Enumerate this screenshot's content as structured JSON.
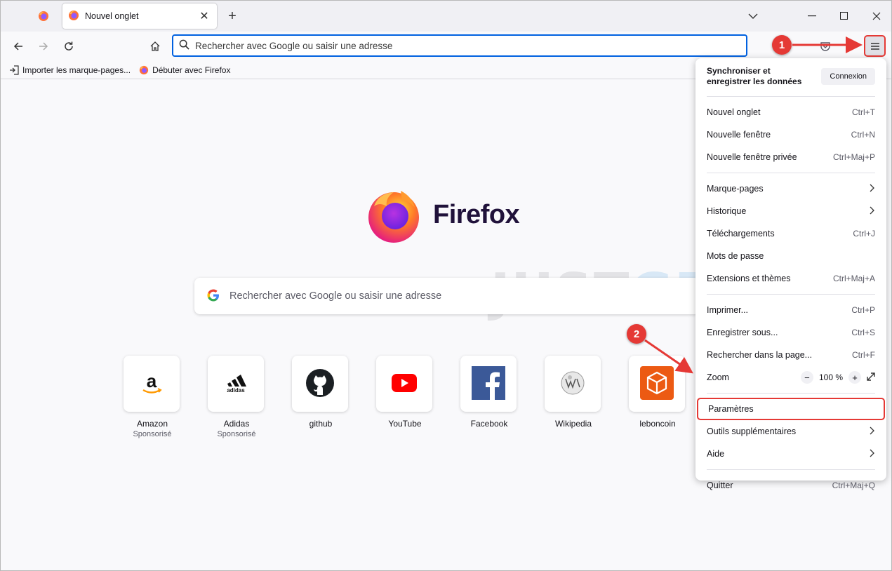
{
  "tab": {
    "title": "Nouvel onglet"
  },
  "urlbar": {
    "placeholder": "Rechercher avec Google ou saisir une adresse"
  },
  "bookmarks": [
    {
      "label": "Importer les marque-pages..."
    },
    {
      "label": "Débuter avec Firefox"
    }
  ],
  "logo": {
    "text": "Firefox"
  },
  "watermark": {
    "part1": "JUST",
    "part2": "GEEK"
  },
  "search": {
    "placeholder": "Rechercher avec Google ou saisir une adresse"
  },
  "tiles": [
    {
      "label": "Amazon",
      "sub": "Sponsorisé"
    },
    {
      "label": "Adidas",
      "sub": "Sponsorisé"
    },
    {
      "label": "github",
      "sub": ""
    },
    {
      "label": "YouTube",
      "sub": ""
    },
    {
      "label": "Facebook",
      "sub": ""
    },
    {
      "label": "Wikipedia",
      "sub": ""
    },
    {
      "label": "leboncoin",
      "sub": ""
    }
  ],
  "menu": {
    "sync_text": "Synchroniser et enregistrer les données",
    "connexion": "Connexion",
    "items": [
      {
        "label": "Nouvel onglet",
        "shortcut": "Ctrl+T"
      },
      {
        "label": "Nouvelle fenêtre",
        "shortcut": "Ctrl+N"
      },
      {
        "label": "Nouvelle fenêtre privée",
        "shortcut": "Ctrl+Maj+P"
      },
      {
        "label": "Marque-pages",
        "shortcut": ""
      },
      {
        "label": "Historique",
        "shortcut": ""
      },
      {
        "label": "Téléchargements",
        "shortcut": "Ctrl+J"
      },
      {
        "label": "Mots de passe",
        "shortcut": ""
      },
      {
        "label": "Extensions et thèmes",
        "shortcut": "Ctrl+Maj+A"
      },
      {
        "label": "Imprimer...",
        "shortcut": "Ctrl+P"
      },
      {
        "label": "Enregistrer sous...",
        "shortcut": "Ctrl+S"
      },
      {
        "label": "Rechercher dans la page...",
        "shortcut": "Ctrl+F"
      },
      {
        "label": "Zoom",
        "shortcut": ""
      },
      {
        "label": "Paramètres",
        "shortcut": ""
      },
      {
        "label": "Outils supplémentaires",
        "shortcut": ""
      },
      {
        "label": "Aide",
        "shortcut": ""
      },
      {
        "label": "Quitter",
        "shortcut": "Ctrl+Maj+Q"
      }
    ],
    "zoom": {
      "minus": "−",
      "value": "100 %",
      "plus": "+"
    }
  },
  "annotations": {
    "step1": "1",
    "step2": "2"
  },
  "colors": {
    "accent": "#0061e0",
    "annotation": "#e53935"
  }
}
